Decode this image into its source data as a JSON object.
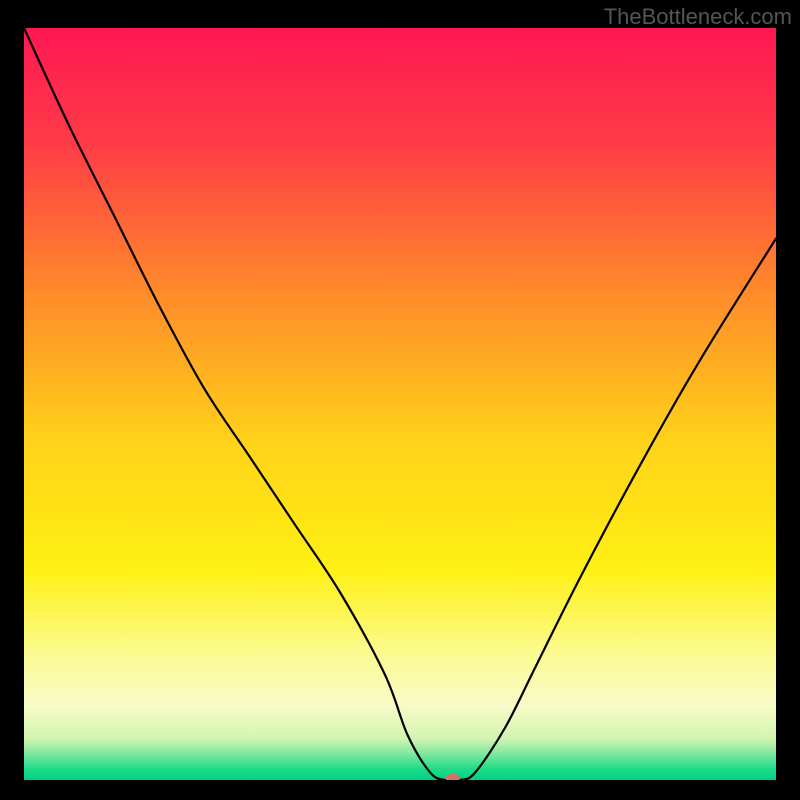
{
  "watermark": "TheBottleneck.com",
  "chart_data": {
    "type": "line",
    "title": "",
    "xlabel": "",
    "ylabel": "",
    "xlim": [
      0,
      100
    ],
    "ylim": [
      0,
      100
    ],
    "series": [
      {
        "name": "bottleneck-curve",
        "x": [
          0,
          6,
          12,
          18,
          24,
          30,
          36,
          42,
          48,
          51,
          54,
          56,
          58,
          60,
          64,
          68,
          74,
          82,
          90,
          100
        ],
        "y": [
          100,
          87,
          75,
          63,
          52,
          43,
          34,
          25,
          14,
          6,
          1,
          0,
          0,
          1,
          7,
          15,
          27,
          42,
          56,
          72
        ]
      }
    ],
    "marker": {
      "x": 57,
      "y": 0.2,
      "color": "#d8706a"
    },
    "background_gradient": {
      "stops": [
        {
          "offset": 0.0,
          "color": "#ff1753"
        },
        {
          "offset": 0.15,
          "color": "#ff3a47"
        },
        {
          "offset": 0.35,
          "color": "#ff8a2a"
        },
        {
          "offset": 0.55,
          "color": "#ffd21a"
        },
        {
          "offset": 0.72,
          "color": "#fff013"
        },
        {
          "offset": 0.83,
          "color": "#fbfb8f"
        },
        {
          "offset": 0.9,
          "color": "#f8fbc8"
        },
        {
          "offset": 0.945,
          "color": "#d2f5b0"
        },
        {
          "offset": 0.965,
          "color": "#7fe8a0"
        },
        {
          "offset": 0.985,
          "color": "#1fdc8a"
        },
        {
          "offset": 1.0,
          "color": "#00d084"
        }
      ]
    }
  }
}
